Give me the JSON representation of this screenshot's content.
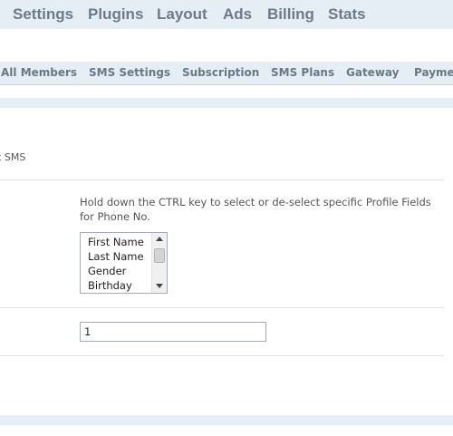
{
  "topnav": {
    "items": [
      "Settings",
      "Plugins",
      "Layout",
      "Ads",
      "Billing",
      "Stats"
    ]
  },
  "subnav": {
    "items": [
      "All Members",
      "SMS Settings",
      "Subscription",
      "SMS Plans",
      "Gateway",
      "Payme"
    ]
  },
  "form": {
    "partial_label": "k SMS",
    "phone_fields_help": "Hold down the CTRL key to select or de-select specific Profile Fields for Phone No.",
    "phone_fields_options": [
      "First Name",
      "Last Name",
      "Gender",
      "Birthday"
    ],
    "numeric_field_value": "1"
  }
}
